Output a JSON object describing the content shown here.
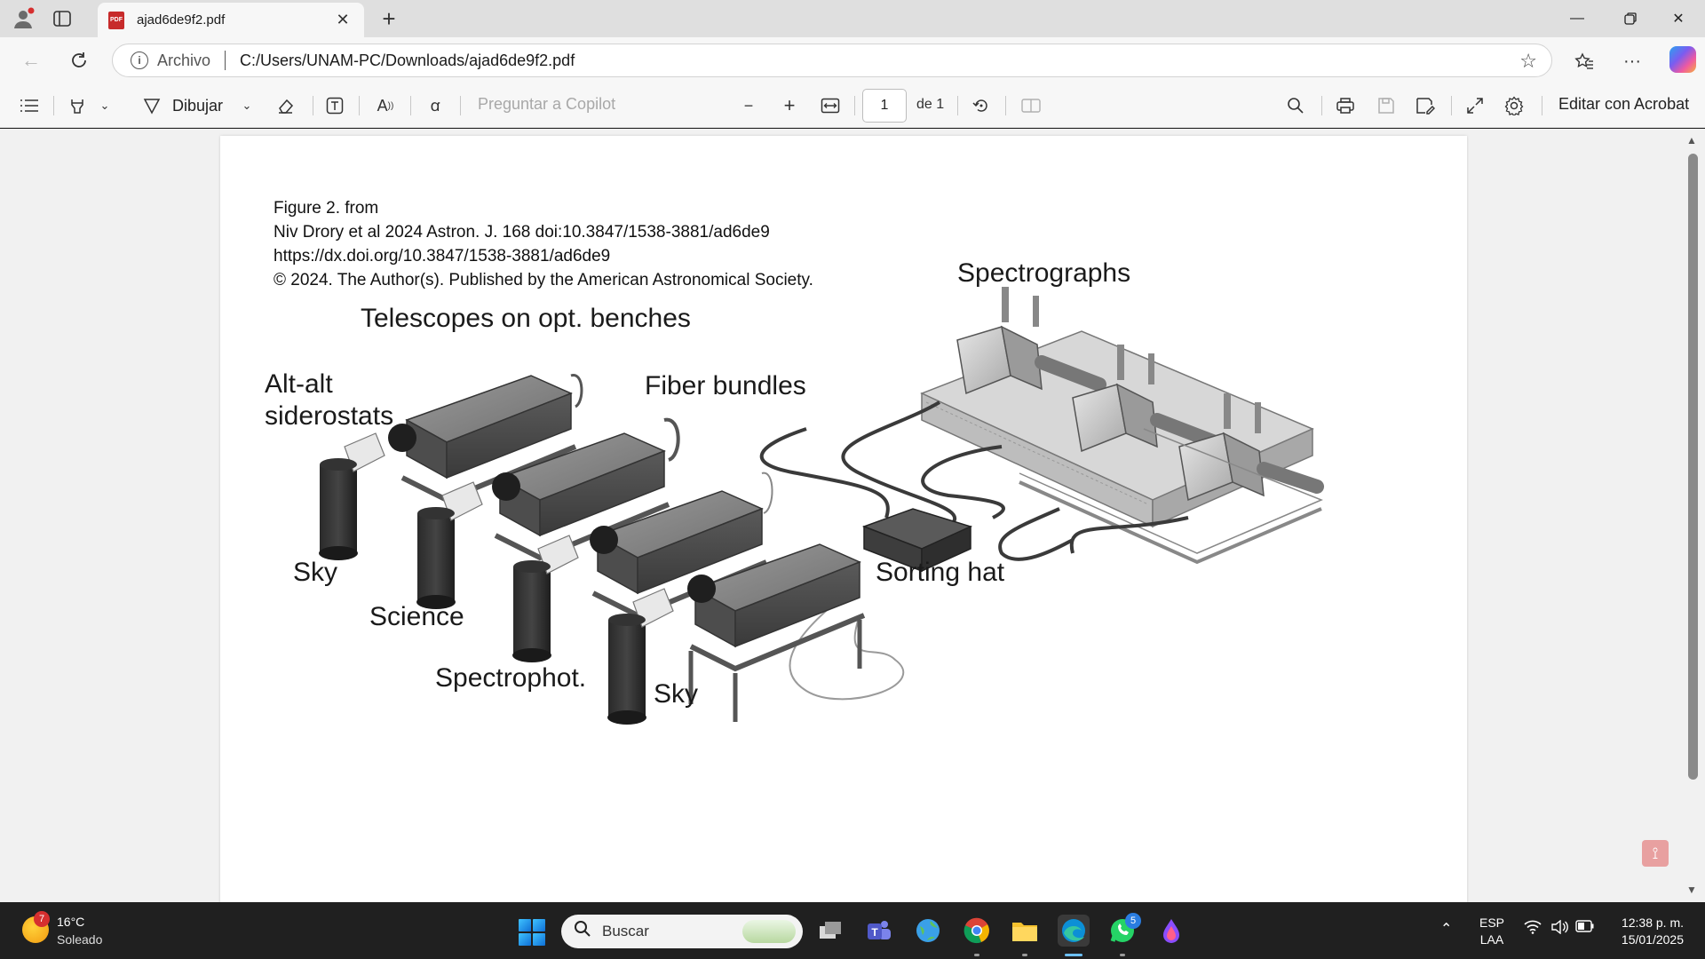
{
  "browser": {
    "tab_title": "ajad6de9f2.pdf",
    "tab_icon": "pdf-icon",
    "new_tab_label": "+",
    "address": {
      "site_label": "Archivo",
      "url": "C:/Users/UNAM-PC/Downloads/ajad6de9f2.pdf"
    }
  },
  "pdf_toolbar": {
    "draw_label": "Dibujar",
    "copilot_prompt": "Preguntar a Copilot",
    "page_current": "1",
    "page_total": "de 1",
    "edit_label": "Editar con Acrobat"
  },
  "document": {
    "caption_lines": [
      "Figure 2. from",
      "Niv Drory et al 2024 Astron. J. 168 doi:10.3847/1538-3881/ad6de9",
      "https://dx.doi.org/10.3847/1538-3881/ad6de9",
      "© 2024. The Author(s). Published by the American Astronomical Society."
    ],
    "figure_labels": {
      "spectrographs": "Spectrographs",
      "telescopes": "Telescopes on opt. benches",
      "siderostats_1": "Alt-alt",
      "siderostats_2": "siderostats",
      "fiber_bundles": "Fiber bundles",
      "sky_1": "Sky",
      "science": "Science",
      "spectrophot": "Spectrophot.",
      "sky_2": "Sky",
      "sorting_hat": "Sorting hat"
    }
  },
  "taskbar": {
    "weather_temp": "16°C",
    "weather_cond": "Soleado",
    "weather_badge": "7",
    "search_placeholder": "Buscar",
    "whatsapp_badge": "5",
    "lang_1": "ESP",
    "lang_2": "LAA",
    "time": "12:38 p. m.",
    "date": "15/01/2025"
  },
  "colors": {
    "titlebar": "#dfdfdf",
    "toolbar": "#f7f7f7",
    "viewer_bg": "#f1f1f1",
    "taskbar": "#202020",
    "metal_dark": "#4a4a4a",
    "metal_mid": "#7a7a7a"
  }
}
